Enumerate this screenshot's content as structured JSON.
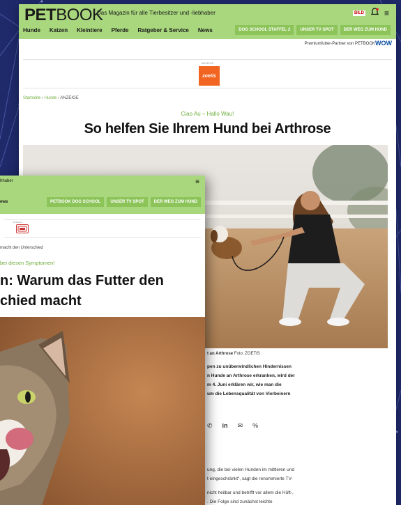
{
  "colors": {
    "background": "#1f2a6b",
    "header_green": "#a9d77d",
    "pill_green": "#8cc45a",
    "accent_green": "#6fae3c",
    "zoetis_orange": "#f26422"
  },
  "back_page": {
    "logo_bold": "PET",
    "logo_light": "BOOK",
    "tagline": "Das Magazin für alle Tierbesitzer und -liebhaber",
    "icons": [
      "bild-logo",
      "bell-icon",
      "menu-icon"
    ],
    "bild_label": "BILD",
    "nav": [
      "Hunde",
      "Katzen",
      "Kleintiere",
      "Pferde",
      "Ratgeber & Service",
      "News"
    ],
    "pills": [
      "DOG SCHOOL STAFFEL 2",
      "UNSER TV SPOT",
      "DER WEG ZUM HUND"
    ],
    "partner_text": "Premiumfutter-Partner von PETBOOK",
    "partner_logo": "WOW",
    "ad_label": "ANZEIGE",
    "ad_brand": "zoetis",
    "breadcrumb": {
      "home": "Startseite",
      "sep1": " › ",
      "section": "Hunde",
      "sep2": " › ",
      "current": "ANZEIGE"
    },
    "kicker": "Ciao Au – Hallo Wau!",
    "title": "So helfen Sie Ihrem Hund bei Arthrose",
    "caption_bold": "t an Arthrose",
    "caption_rest": " Foto: ZOETIS",
    "lead_lines": [
      "pen zu unüberwindlichen Hindernissen",
      "n Hunde an Arthrose erkranken, wird der",
      "m 4. Juni erklären wir, wie man die",
      "um die Lebensqualität von Vierbeinern"
    ],
    "share_icons": [
      "whatsapp-icon",
      "linkedin-icon",
      "mail-icon",
      "link-icon"
    ],
    "share_glyphs": [
      "✆",
      "in",
      "✉",
      "%"
    ],
    "body_paragraphs": [
      [
        "ung, die bei vielen Hunden im mittleren und",
        "t eingeschränkt“, sagt die renommierte TV-"
      ],
      [
        "nicht heilbar und betrifft vor allem die Hüft-,",
        ". Die Folge sind zunächst leichte"
      ]
    ]
  },
  "front_page": {
    "tagline": "hhaber",
    "nav": "ews",
    "pills": [
      "PETBOOK DOG SCHOOL",
      "UNSER TV SPOT",
      "DER WEG ZUM HUND"
    ],
    "ad_label": "ANZEIGE",
    "breadcrumb": "macht den Unterschied",
    "kicker": "bei diesen Symptomen!",
    "title_lines": [
      "n: Warum das Futter den",
      "chied macht"
    ]
  }
}
